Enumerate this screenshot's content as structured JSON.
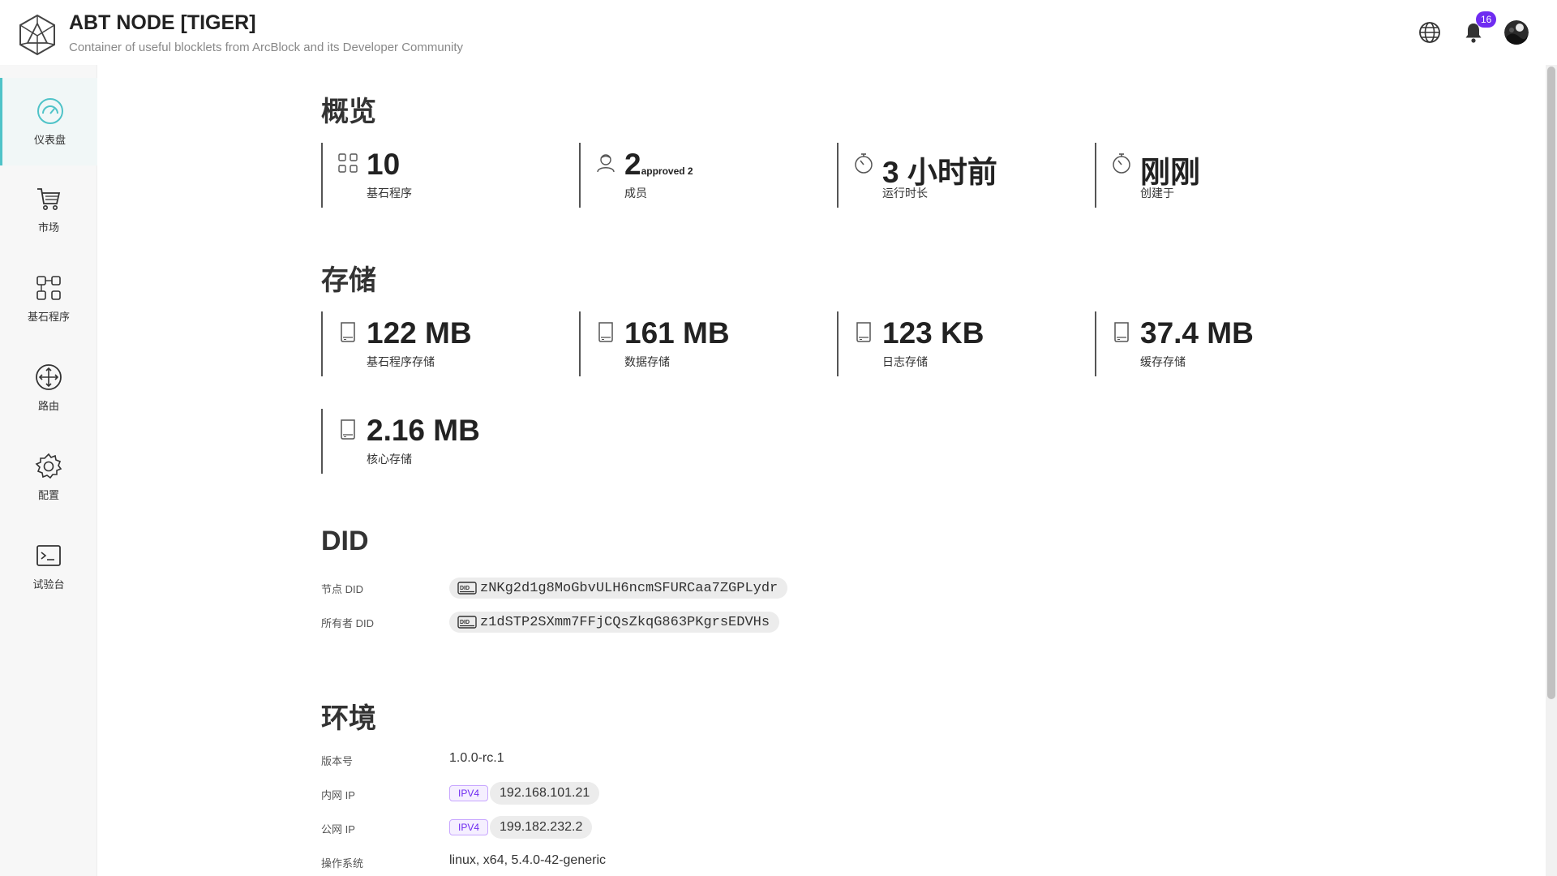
{
  "header": {
    "title": "ABT NODE [TIGER]",
    "subtitle": "Container of useful blocklets from ArcBlock and its Developer Community",
    "notification_count": "16"
  },
  "sidebar": {
    "items": [
      {
        "label": "仪表盘",
        "icon": "dashboard-gauge-icon",
        "active": true
      },
      {
        "label": "市场",
        "icon": "cart-icon",
        "active": false
      },
      {
        "label": "基石程序",
        "icon": "blocks-icon",
        "active": false
      },
      {
        "label": "路由",
        "icon": "route-icon",
        "active": false
      },
      {
        "label": "配置",
        "icon": "gear-icon",
        "active": false
      },
      {
        "label": "试验台",
        "icon": "terminal-icon",
        "active": false
      }
    ]
  },
  "overview": {
    "title": "概览",
    "stats": [
      {
        "value": "10",
        "sub": "",
        "label": "基石程序"
      },
      {
        "value": "2",
        "sub": "approved 2",
        "label": "成员"
      },
      {
        "value": "3 小时前",
        "sub": "",
        "label": "运行时长"
      },
      {
        "value": "刚刚",
        "sub": "",
        "label": "创建于"
      }
    ]
  },
  "storage": {
    "title": "存储",
    "stats": [
      {
        "value": "122 MB",
        "label": "基石程序存储"
      },
      {
        "value": "161 MB",
        "label": "数据存储"
      },
      {
        "value": "123 KB",
        "label": "日志存储"
      },
      {
        "value": "37.4 MB",
        "label": "缓存存储"
      },
      {
        "value": "2.16 MB",
        "label": "核心存储"
      }
    ]
  },
  "did": {
    "title": "DID",
    "node_label": "节点 DID",
    "node_value": "zNKg2d1g8MoGbvULH6ncmSFURCaa7ZGPLydr",
    "owner_label": "所有者 DID",
    "owner_value": "z1dSTP2SXmm7FFjCQsZkqG863PKgrsEDVHs"
  },
  "env": {
    "title": "环境",
    "version_label": "版本号",
    "version_value": "1.0.0-rc.1",
    "internal_ip_label": "内网 IP",
    "internal_ip_tag": "IPV4",
    "internal_ip_value": "192.168.101.21",
    "public_ip_label": "公网 IP",
    "public_ip_tag": "IPV4",
    "public_ip_value": "199.182.232.2",
    "os_label": "操作系统",
    "os_value": "linux, x64, 5.4.0-42-generic"
  },
  "colors": {
    "accent": "#4fc3c8",
    "badge": "#6f2cf1"
  }
}
